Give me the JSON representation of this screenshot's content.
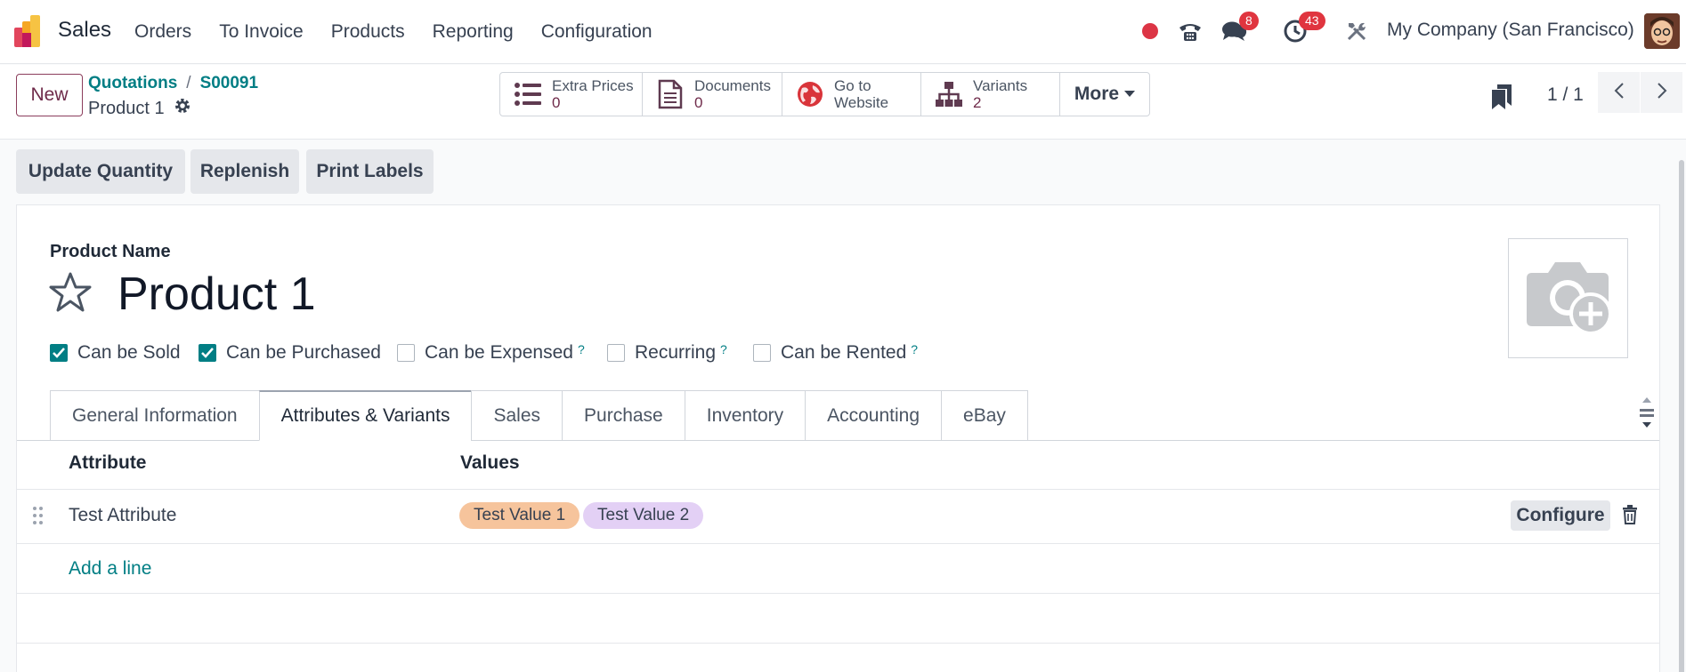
{
  "navbar": {
    "app_name": "Sales",
    "menu": [
      "Orders",
      "To Invoice",
      "Products",
      "Reporting",
      "Configuration"
    ],
    "messages_badge": "8",
    "activities_badge": "43",
    "company": "My Company (San Francisco)"
  },
  "control_panel": {
    "new_label": "New",
    "breadcrumb": [
      "Quotations",
      "S00091"
    ],
    "record_name": "Product 1",
    "smart_buttons": [
      {
        "label": "Extra Prices",
        "value": "0",
        "icon": "list-icon"
      },
      {
        "label": "Documents",
        "value": "0",
        "icon": "document-icon"
      },
      {
        "label": "Go to",
        "value": "Website",
        "icon": "globe-icon"
      },
      {
        "label": "Variants",
        "value": "2",
        "icon": "sitemap-icon"
      }
    ],
    "more_label": "More",
    "pager": "1 / 1"
  },
  "actions": [
    "Update Quantity",
    "Replenish",
    "Print Labels"
  ],
  "form": {
    "product_name_label": "Product Name",
    "product_name": "Product 1",
    "checkboxes": [
      {
        "label": "Can be Sold",
        "checked": true,
        "help": ""
      },
      {
        "label": "Can be Purchased",
        "checked": true,
        "help": ""
      },
      {
        "label": "Can be Expensed",
        "checked": false,
        "help": "?"
      },
      {
        "label": "Recurring",
        "checked": false,
        "help": "?"
      },
      {
        "label": "Can be Rented",
        "checked": false,
        "help": "?"
      }
    ],
    "tabs": [
      "General Information",
      "Attributes & Variants",
      "Sales",
      "Purchase",
      "Inventory",
      "Accounting",
      "eBay"
    ],
    "active_tab": "Attributes & Variants",
    "table": {
      "headers": [
        "Attribute",
        "Values"
      ],
      "rows": [
        {
          "attribute": "Test Attribute",
          "values": [
            {
              "label": "Test Value 1",
              "color": "#f6c49c"
            },
            {
              "label": "Test Value 2",
              "color": "#e3d0f5"
            }
          ],
          "configure_label": "Configure"
        }
      ],
      "add_line": "Add a line"
    }
  },
  "colors": {
    "brand": "#6f2b4a",
    "accent": "#017e84",
    "badge": "#e0353f"
  }
}
